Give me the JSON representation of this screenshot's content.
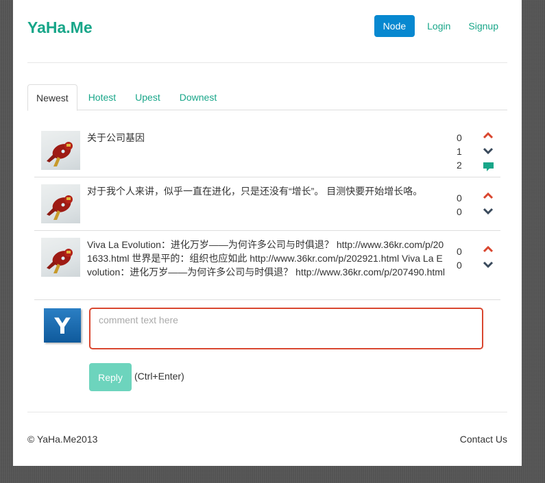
{
  "header": {
    "brand": "YaHa.Me",
    "nav": [
      {
        "label": "Node",
        "active": true
      },
      {
        "label": "Login",
        "active": false
      },
      {
        "label": "Signup",
        "active": false
      }
    ]
  },
  "tabs": [
    {
      "label": "Newest",
      "active": true
    },
    {
      "label": "Hotest",
      "active": false
    },
    {
      "label": "Upest",
      "active": false
    },
    {
      "label": "Downest",
      "active": false
    }
  ],
  "posts": [
    {
      "text": "关于公司基因",
      "up_count": "0",
      "down_count": "1",
      "comment_count": "2",
      "icons": [
        "upvote-icon",
        "downvote-icon",
        "comment-icon"
      ]
    },
    {
      "text": "对于我个人来讲，似乎一直在进化，只是还没有“增长”。 目测快要开始增长咯。",
      "up_count": "0",
      "down_count": "0",
      "icons": [
        "upvote-icon",
        "downvote-icon"
      ]
    },
    {
      "text": "Viva La Evolution：进化万岁——为何许多公司与时俱退？ http://www.36kr.com/p/201633.html 世界是平的：组织也应如此 http://www.36kr.com/p/202921.html Viva La Evolution：进化万岁——为何许多公司与时俱退？ http://www.36kr.com/p/207490.html",
      "up_count": "0",
      "down_count": "0",
      "icons": [
        "upvote-icon",
        "downvote-icon"
      ]
    }
  ],
  "composer": {
    "avatar_letter": "Y",
    "placeholder": "comment text here",
    "value": "",
    "reply_label": "Reply",
    "shortcut_hint": "(Ctrl+Enter)"
  },
  "footer": {
    "copyright": "© YaHa.Me2013",
    "contact": "Contact Us"
  },
  "colors": {
    "brand": "#18a689",
    "active_nav": "#0788d0",
    "upvote": "#d9462f",
    "downvote": "#3a4a5c",
    "comment": "#18a689",
    "input_border": "#d9462f",
    "reply_button": "#6dd4bd"
  }
}
